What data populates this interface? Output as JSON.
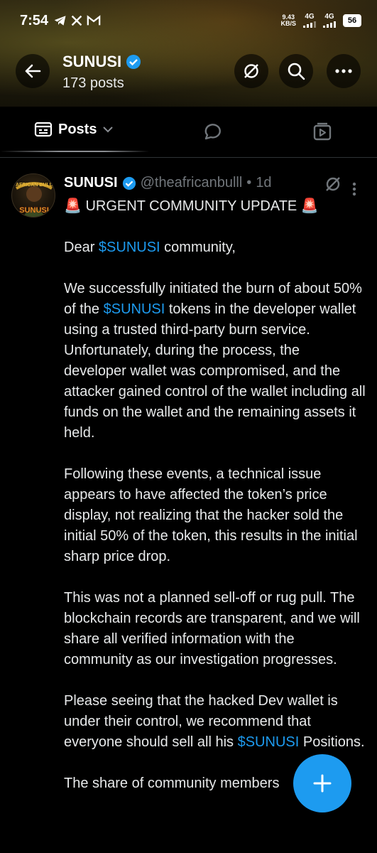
{
  "status_bar": {
    "time": "7:54",
    "notification_icons": [
      "telegram-icon",
      "x-logo-icon",
      "gmail-icon"
    ],
    "net_speed_value": "9.43",
    "net_speed_unit": "KB/S",
    "network_1": "4G",
    "network_2": "4G",
    "battery": "56"
  },
  "header": {
    "name": "SUNUSI",
    "posts_count": "173 posts",
    "verified": true
  },
  "tabs": {
    "active_label": "Posts"
  },
  "post": {
    "avatar_text_top": "AFRICAN BULL",
    "avatar_text_bottom": "SUNUSI",
    "author": "SUNUSI",
    "handle": "@theafricanbulll",
    "separator": "•",
    "age": "1d",
    "headline_emoji_left": "🚨",
    "headline": "URGENT COMMUNITY UPDATE",
    "headline_emoji_right": "🚨",
    "p1_pre": "Dear ",
    "p1_cashtag": "$SUNUSI",
    "p1_post": " community,",
    "p2_pre": "We successfully initiated the burn of about 50% of the ",
    "p2_cashtag": "$SUNUSI",
    "p2_post": " tokens in the developer wallet using a trusted third-party burn service. Unfortunately, during the process, the developer wallet was compromised, and the attacker gained control of the wallet including all funds on the wallet and the remaining assets it held.",
    "p3": "Following these events, a technical issue appears to have affected the token’s price display, not realizing that the hacker sold the initial 50% of the token, this results in the initial sharp price drop.",
    "p4": "This was not a planned sell-off or rug pull. The blockchain records are transparent, and we will share all verified information with the community as our investigation progresses.",
    "p5_pre": "Please seeing that the hacked Dev wallet is under their control, we recommend that everyone should sell all his ",
    "p5_cashtag": "$SUNUSI",
    "p5_post": " Positions.",
    "p6_partial": "The share of community members"
  },
  "colors": {
    "accent": "#1d9bf0",
    "secondary_text": "#71767b",
    "background": "#000000"
  }
}
